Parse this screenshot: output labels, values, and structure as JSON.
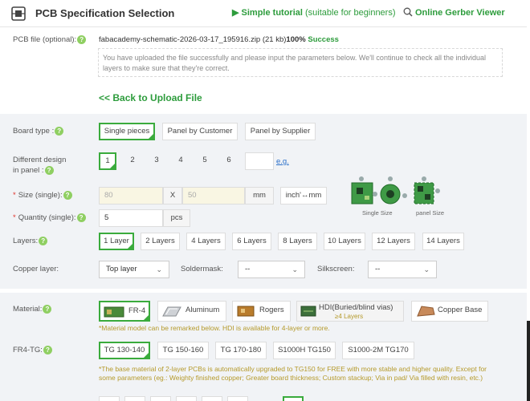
{
  "header": {
    "title": "PCB Specification Selection",
    "tutorial_link": "Simple tutorial",
    "tutorial_suffix": "(suitable for beginners)",
    "gerber_link": "Online Gerber Viewer"
  },
  "pcb_file": {
    "label": "PCB file (optional):",
    "filename": "fabacademy-schematic-2026-03-17_195916.zip (21 kb)",
    "progress": "100%",
    "status": "Success",
    "message": "You have uploaded the file successfully and please input the parameters below. We'll continue to check all the individual layers to make sure that they're correct.",
    "back_link": "<< Back to Upload File"
  },
  "board_type": {
    "label": "Board type :",
    "options": [
      "Single pieces",
      "Panel by Customer",
      "Panel by Supplier"
    ]
  },
  "different_design": {
    "label_line1": "Different design",
    "label_line2": "in panel :",
    "options": [
      "1",
      "2",
      "3",
      "4",
      "5",
      "6"
    ],
    "eg": "e.g."
  },
  "size": {
    "label": "Size (single):",
    "width": "80",
    "x": "X",
    "height": "50",
    "unit": "mm",
    "convert": "inch'↔mm",
    "single_size": "Single Size",
    "panel_size": "panel Size"
  },
  "quantity": {
    "label": "Quantity (single):",
    "value": "5",
    "unit": "pcs"
  },
  "layers": {
    "label": "Layers:",
    "options": [
      "1 Layer",
      "2 Layers",
      "4 Layers",
      "6 Layers",
      "8 Layers",
      "10 Layers",
      "12 Layers",
      "14 Layers"
    ]
  },
  "copper_layer": {
    "label": "Copper layer:",
    "value": "Top layer",
    "soldermask_label": "Soldermask:",
    "soldermask_value": "--",
    "silkscreen_label": "Silkscreen:",
    "silkscreen_value": "--"
  },
  "material": {
    "label": "Material:",
    "options": [
      "FR-4",
      "Aluminum",
      "Rogers",
      "HDI(Buried/blind vias)",
      "Copper Base"
    ],
    "hdi_sub": "≥4 Layers",
    "note": "*Material model can be remarked below. HDI is available for 4-layer or more."
  },
  "fr4_tg": {
    "label": "FR4-TG:",
    "options": [
      "TG 130-140",
      "TG 150-160",
      "TG 170-180",
      "S1000H TG150",
      "S1000-2M TG170"
    ],
    "note": "*The base material of 2-layer PCBs is automatically upgraded to TG150 for FREE with more stable and higher quality. Except for some parameters (eg.: Weighty finished copper; Greater board thickness; Custom stackup; Via in pad/ Via filled with resin, etc.)"
  },
  "colors": {
    "accent": "#3aab3c",
    "link": "#2d9c3c",
    "note": "#b59a2b",
    "required": "#e0332b"
  }
}
